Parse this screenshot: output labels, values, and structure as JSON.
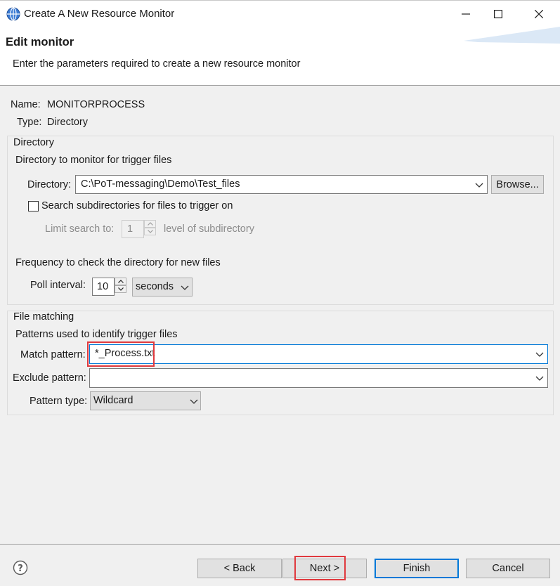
{
  "window": {
    "title": "Create A New Resource Monitor",
    "icons": {
      "app": "globe-icon",
      "minimize": "minimize-icon",
      "maximize": "maximize-icon",
      "close": "close-icon"
    }
  },
  "banner": {
    "title": "Edit monitor",
    "description": "Enter the parameters required to create a new resource monitor"
  },
  "monitor": {
    "name_label": "Name:",
    "name_value": "MONITORPROCESS",
    "type_label": "Type:",
    "type_value": "Directory"
  },
  "directory_group": {
    "title": "Directory",
    "subtitle": "Directory to monitor for trigger files",
    "directory_label": "Directory:",
    "directory_value": "C:\\PoT-messaging\\Demo\\Test_files",
    "browse_label": "Browse...",
    "subdirs_label": "Search subdirectories for files to trigger on",
    "subdirs_checked": false,
    "limit_label": "Limit search to:",
    "limit_value": "1",
    "limit_suffix": "level of subdirectory",
    "frequency_label": "Frequency to check the directory for new files",
    "poll_label": "Poll interval:",
    "poll_value": "10",
    "poll_unit": "seconds"
  },
  "matching_group": {
    "title": "File matching",
    "subtitle": "Patterns used to identify trigger files",
    "match_label": "Match pattern:",
    "match_value": "*_Process.txt",
    "exclude_label": "Exclude pattern:",
    "exclude_value": "",
    "pattern_type_label": "Pattern type:",
    "pattern_type_value": "Wildcard"
  },
  "footer": {
    "help_icon": "help-icon",
    "back_label": "< Back",
    "next_label": "Next >",
    "finish_label": "Finish",
    "cancel_label": "Cancel"
  },
  "colors": {
    "highlight": "#e0393e",
    "focus": "#0078d7",
    "panel": "#f0f0f0",
    "banner_art": "#cfe0f3"
  }
}
